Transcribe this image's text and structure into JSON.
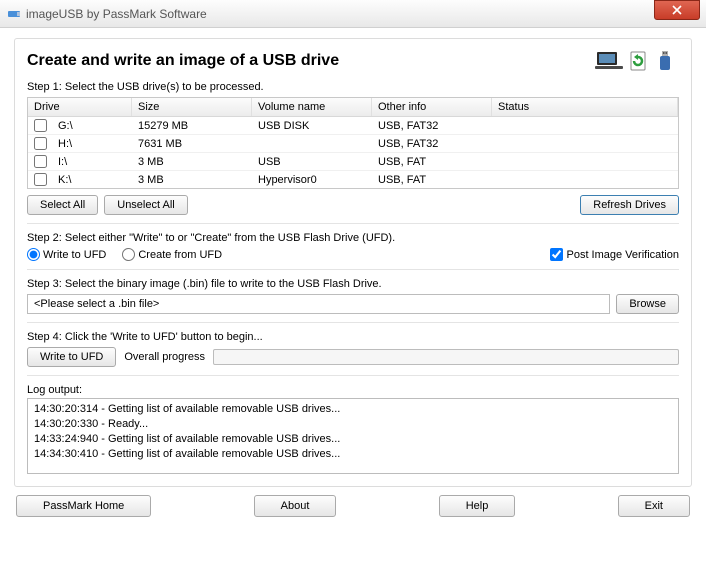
{
  "title": "imageUSB by PassMark Software",
  "header": "Create and write an image of a USB drive",
  "step1": "Step 1: Select the USB drive(s) to be processed.",
  "columns": {
    "drive": "Drive",
    "size": "Size",
    "volume": "Volume name",
    "info": "Other info",
    "status": "Status"
  },
  "drives": [
    {
      "drive": "G:\\",
      "size": "15279 MB",
      "volume": "USB DISK",
      "info": "USB, FAT32"
    },
    {
      "drive": "H:\\",
      "size": "7631 MB",
      "volume": "",
      "info": "USB, FAT32"
    },
    {
      "drive": "I:\\",
      "size": "3 MB",
      "volume": "USB",
      "info": "USB, FAT"
    },
    {
      "drive": "K:\\",
      "size": "3 MB",
      "volume": "Hypervisor0",
      "info": "USB, FAT"
    }
  ],
  "buttons": {
    "selectAll": "Select All",
    "unselectAll": "Unselect All",
    "refresh": "Refresh Drives",
    "browse": "Browse",
    "writeUFD": "Write to UFD",
    "passmarkHome": "PassMark Home",
    "about": "About",
    "help": "Help",
    "exit": "Exit"
  },
  "step2": "Step 2: Select either \"Write\" to or \"Create\" from the USB Flash Drive (UFD).",
  "radio": {
    "write": "Write to UFD",
    "create": "Create from UFD"
  },
  "postVerify": "Post Image Verification",
  "step3": "Step 3: Select the binary image (.bin) file to write to the USB Flash Drive.",
  "filePlaceholder": "<Please select a .bin file>",
  "step4": "Step 4: Click the 'Write to UFD' button to begin...",
  "progressLabel": "Overall progress",
  "logLabel": "Log output:",
  "logLines": "14:30:20:314 - Getting list of available removable USB drives...\n14:30:20:330 - Ready...\n14:33:24:940 - Getting list of available removable USB drives...\n14:34:30:410 - Getting list of available removable USB drives..."
}
